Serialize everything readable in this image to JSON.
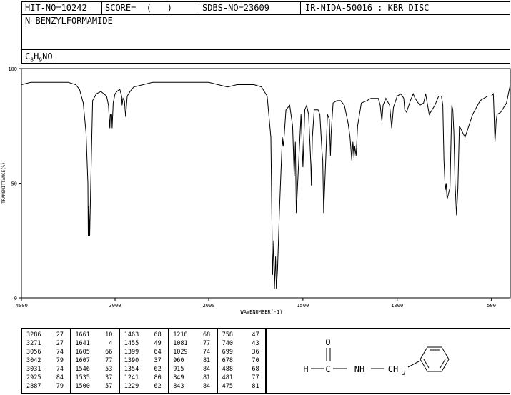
{
  "header": {
    "hit_no": "HIT-NO=10242",
    "score": "SCORE=  (   )",
    "sdbs_no": "SDBS-NO=23609",
    "ir_info": "IR-NIDA-50016 : KBR DISC"
  },
  "compound": {
    "name": "N-BENZYLFORMAMIDE",
    "formula_parts": [
      "C",
      "8",
      "H",
      "9",
      "NO"
    ]
  },
  "chart_data": {
    "type": "line",
    "title": "",
    "xlabel": "WAVENUMBER(-1)",
    "ylabel": "TRANSMITTANCE(%)",
    "xlim": [
      4000,
      400
    ],
    "ylim": [
      0,
      100
    ],
    "x_ticks": [
      4000,
      3000,
      2000,
      1500,
      1000,
      500
    ],
    "y_ticks": [
      0,
      50,
      100
    ],
    "x_tick_labels": [
      "4000",
      "3000",
      "2000",
      "1500",
      "1000",
      "500"
    ],
    "y_tick_labels": [
      "0",
      "50",
      "100"
    ],
    "grid": false,
    "x": [
      4000,
      3900,
      3800,
      3700,
      3600,
      3500,
      3420,
      3380,
      3340,
      3310,
      3290,
      3286,
      3280,
      3271,
      3262,
      3240,
      3200,
      3150,
      3090,
      3070,
      3056,
      3050,
      3042,
      3036,
      3031,
      3020,
      3000,
      2980,
      2950,
      2930,
      2925,
      2915,
      2900,
      2887,
      2870,
      2840,
      2800,
      2700,
      2600,
      2500,
      2400,
      2300,
      2200,
      2100,
      2000,
      1950,
      1900,
      1850,
      1800,
      1760,
      1720,
      1690,
      1670,
      1661,
      1655,
      1651,
      1645,
      1641,
      1635,
      1625,
      1615,
      1609,
      1605,
      1600,
      1590,
      1570,
      1555,
      1546,
      1540,
      1535,
      1525,
      1510,
      1500,
      1490,
      1480,
      1470,
      1463,
      1458,
      1455,
      1450,
      1440,
      1420,
      1410,
      1399,
      1395,
      1390,
      1380,
      1370,
      1360,
      1354,
      1350,
      1340,
      1320,
      1300,
      1280,
      1260,
      1250,
      1241,
      1235,
      1229,
      1225,
      1218,
      1210,
      1190,
      1160,
      1140,
      1120,
      1100,
      1090,
      1081,
      1075,
      1060,
      1040,
      1029,
      1020,
      1000,
      980,
      965,
      960,
      950,
      930,
      915,
      905,
      880,
      860,
      849,
      843,
      830,
      800,
      780,
      765,
      758,
      752,
      745,
      740,
      735,
      720,
      710,
      705,
      699,
      693,
      685,
      678,
      670,
      640,
      600,
      560,
      520,
      500,
      490,
      488,
      484,
      481,
      478,
      475,
      470,
      450,
      420,
      400
    ],
    "y": [
      93,
      94,
      94,
      94,
      94,
      94,
      93,
      91,
      85,
      72,
      50,
      27,
      40,
      27,
      45,
      86,
      89,
      90,
      88,
      84,
      74,
      80,
      79,
      80,
      74,
      85,
      89,
      90,
      91,
      88,
      84,
      87,
      86,
      79,
      88,
      90,
      92,
      93,
      94,
      94,
      94,
      94,
      94,
      94,
      94,
      93,
      92,
      93,
      93,
      93,
      92,
      88,
      70,
      10,
      25,
      4,
      18,
      4,
      12,
      37,
      58,
      70,
      66,
      70,
      82,
      84,
      75,
      53,
      68,
      37,
      55,
      80,
      57,
      82,
      84,
      80,
      68,
      58,
      49,
      70,
      82,
      82,
      80,
      64,
      60,
      37,
      58,
      80,
      78,
      62,
      72,
      85,
      86,
      86,
      84,
      76,
      70,
      60,
      68,
      61,
      66,
      62,
      75,
      85,
      86,
      87,
      87,
      87,
      84,
      77,
      84,
      87,
      84,
      74,
      83,
      88,
      89,
      87,
      82,
      81,
      86,
      89,
      87,
      84,
      85,
      89,
      86,
      80,
      84,
      88,
      88,
      84,
      60,
      47,
      50,
      43,
      48,
      84,
      82,
      72,
      50,
      36,
      48,
      75,
      70,
      80,
      86,
      88,
      88,
      89,
      85,
      75,
      68,
      72,
      77,
      80,
      81,
      85,
      93,
      90,
      88
    ]
  },
  "peak_table": [
    [
      [
        "3286",
        "27"
      ],
      [
        "3271",
        "27"
      ],
      [
        "3056",
        "74"
      ],
      [
        "3042",
        "79"
      ],
      [
        "3031",
        "74"
      ],
      [
        "2925",
        "84"
      ],
      [
        "2887",
        "79"
      ]
    ],
    [
      [
        "1661",
        "10"
      ],
      [
        "1641",
        "4"
      ],
      [
        "1605",
        "66"
      ],
      [
        "1607",
        "77"
      ],
      [
        "1546",
        "53"
      ],
      [
        "1535",
        "37"
      ],
      [
        "1500",
        "57"
      ]
    ],
    [
      [
        "1463",
        "68"
      ],
      [
        "1455",
        "49"
      ],
      [
        "1399",
        "64"
      ],
      [
        "1390",
        "37"
      ],
      [
        "1354",
        "62"
      ],
      [
        "1241",
        "80"
      ],
      [
        "1229",
        "62"
      ]
    ],
    [
      [
        "1218",
        "68"
      ],
      [
        "1081",
        "77"
      ],
      [
        "1029",
        "74"
      ],
      [
        "960",
        "81"
      ],
      [
        "915",
        "84"
      ],
      [
        "849",
        "81"
      ],
      [
        "843",
        "84"
      ]
    ],
    [
      [
        "758",
        "47"
      ],
      [
        "740",
        "43"
      ],
      [
        "699",
        "36"
      ],
      [
        "678",
        "70"
      ],
      [
        "488",
        "68"
      ],
      [
        "481",
        "77"
      ],
      [
        "475",
        "81"
      ]
    ]
  ],
  "structure": {
    "h": "H",
    "c": "C",
    "o": "O",
    "nh": "NH",
    "ch2": "CH",
    "ch2_sub": "2"
  }
}
